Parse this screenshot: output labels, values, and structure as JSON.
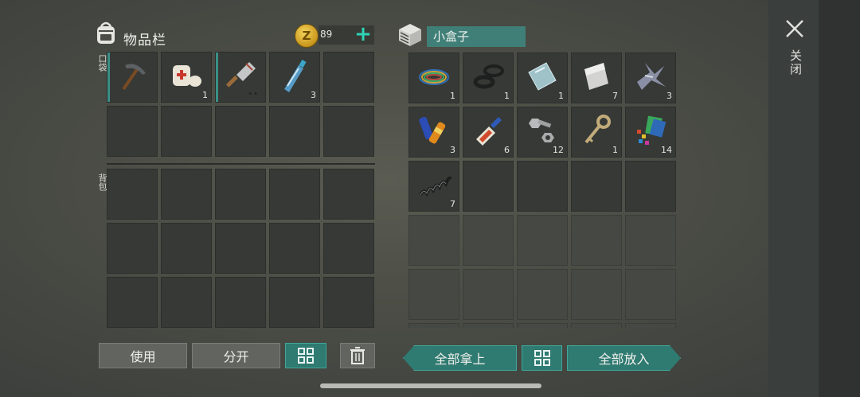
{
  "inventory": {
    "title": "物品栏",
    "coins": "89",
    "pocket_label": "口袋",
    "backpack_label": "背包",
    "pocket_items": [
      {
        "icon": "pickaxe-icon",
        "qty": ""
      },
      {
        "icon": "bandage-icon",
        "qty": "1"
      },
      {
        "icon": "cleaver-icon",
        "qty": ""
      },
      {
        "icon": "water-bottle-icon",
        "qty": "3"
      }
    ]
  },
  "container": {
    "name": "小盒子",
    "items": [
      {
        "icon": "wires-icon",
        "qty": "1"
      },
      {
        "icon": "rubber-rings-icon",
        "qty": "1"
      },
      {
        "icon": "glass-pane-icon",
        "qty": "1"
      },
      {
        "icon": "metal-sheet-icon",
        "qty": "7"
      },
      {
        "icon": "scrap-metal-icon",
        "qty": "3"
      },
      {
        "icon": "batteries-icon",
        "qty": "3"
      },
      {
        "icon": "glue-icon",
        "qty": "6"
      },
      {
        "icon": "nuts-bolts-icon",
        "qty": "12"
      },
      {
        "icon": "key-icon",
        "qty": "1"
      },
      {
        "icon": "plastic-parts-icon",
        "qty": "14"
      },
      {
        "icon": "spring-icon",
        "qty": "7"
      }
    ]
  },
  "buttons": {
    "use": "使用",
    "split": "分开",
    "take_all": "全部拿上",
    "put_all": "全部放入",
    "close": "关闭"
  },
  "colors": {
    "accent": "#2fd3b6",
    "teal_button": "#2f7a71",
    "box_name_bg": "#3f7f77"
  }
}
